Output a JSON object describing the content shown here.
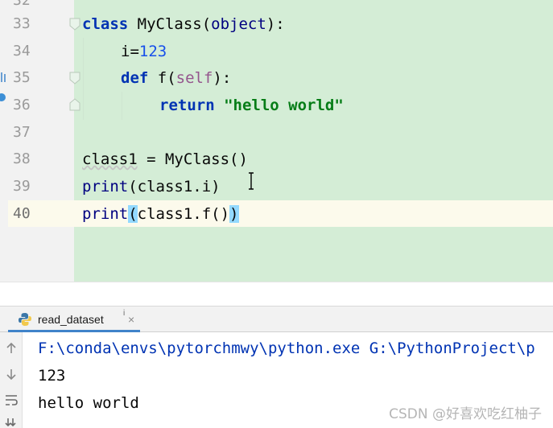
{
  "editor": {
    "partial_top_line_number": "32",
    "lines": [
      {
        "number": "33",
        "t1": "class",
        "t2": " MyClass(",
        "t3": "object",
        "t4": "):"
      },
      {
        "number": "34",
        "t1": "i=",
        "t2": "123"
      },
      {
        "number": "35",
        "t1": "def",
        "t2": " f(",
        "t3": "self",
        "t4": "):"
      },
      {
        "number": "36",
        "t1": "return",
        "t2": " ",
        "t3": "\"hello world\""
      },
      {
        "number": "37"
      },
      {
        "number": "38",
        "t1": "class1",
        "t2": " = MyClass()"
      },
      {
        "number": "39",
        "t1": "print",
        "t2": "(class1.i)"
      },
      {
        "number": "40",
        "t1": "print",
        "t2": "(",
        "t3": "class1.f()",
        "t4": ")"
      }
    ]
  },
  "run_panel": {
    "tab_label": "read_dataset",
    "tab_pin": "i",
    "tab_close": "×",
    "output": [
      "F:\\conda\\envs\\pytorchmwy\\python.exe G:\\PythonProject\\p",
      "123",
      "hello world"
    ],
    "toolbar_icons": [
      "arrow-up-icon",
      "arrow-down-icon",
      "soft-wrap-icon",
      "scroll-to-end-icon"
    ]
  },
  "watermark": "CSDN @好喜欢吃红柚子",
  "colors": {
    "keyword": "#0033b3",
    "number": "#1750eb",
    "string": "#067d17",
    "self": "#94558d",
    "highlight_bg": "#d4edd6",
    "paren_match": "#93d9ff",
    "tab_underline": "#4083c9"
  }
}
